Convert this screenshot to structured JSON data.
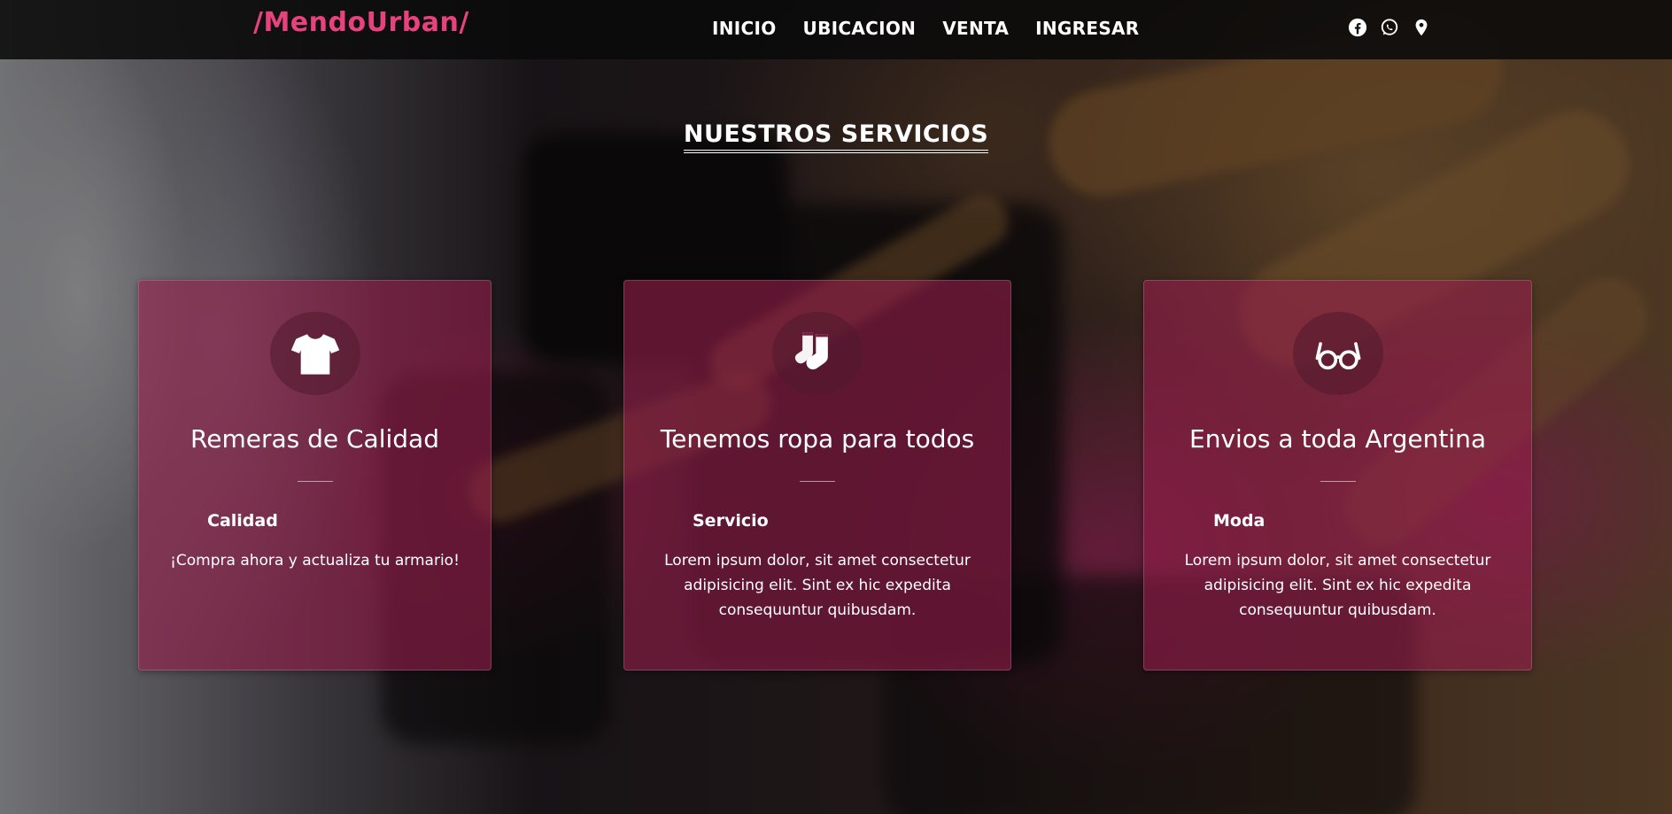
{
  "brand": {
    "logo": "/MendoUrban/",
    "accent": "#e8427c"
  },
  "nav": {
    "items": [
      {
        "label": "INICIO"
      },
      {
        "label": "UBICACION"
      },
      {
        "label": "VENTA"
      },
      {
        "label": "INGRESAR"
      }
    ],
    "social": [
      "facebook-icon",
      "whatsapp-icon",
      "map-pin-icon"
    ]
  },
  "section": {
    "title": "NUESTROS SERVICIOS"
  },
  "cards": [
    {
      "icon": "tshirt-icon",
      "title": "Remeras de Calidad",
      "subtitle": "Calidad",
      "text": "¡Compra ahora y actualiza tu armario!"
    },
    {
      "icon": "socks-icon",
      "title": "Tenemos ropa para todos",
      "subtitle": "Servicio",
      "text": "Lorem ipsum dolor, sit amet consectetur adipisicing elit. Sint ex hic expedita consequuntur quibusdam."
    },
    {
      "icon": "glasses-icon",
      "title": "Envios a toda Argentina",
      "subtitle": "Moda",
      "text": "Lorem ipsum dolor, sit amet consectetur adipisicing elit. Sint ex hic expedita consequuntur quibusdam."
    }
  ]
}
